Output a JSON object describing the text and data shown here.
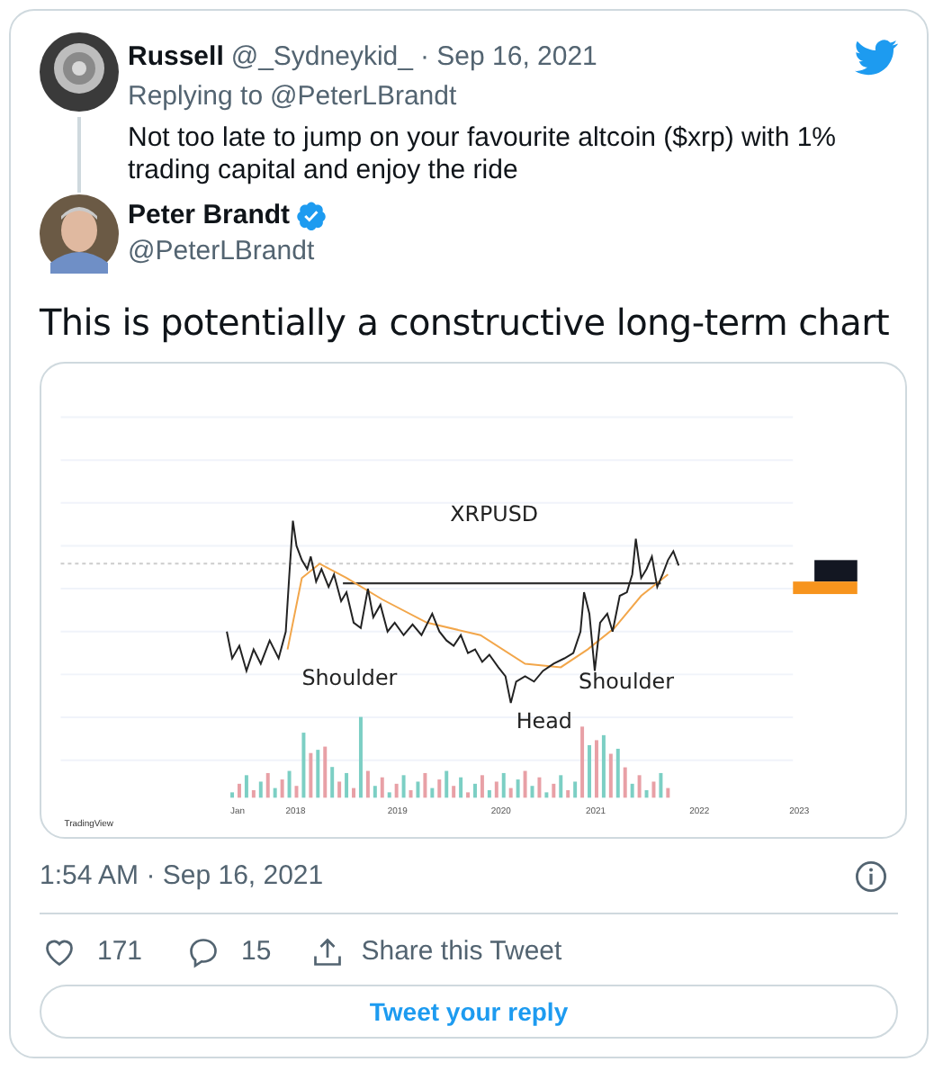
{
  "reply_tweet": {
    "name": "Russell",
    "handle": "@_Sydneykid_",
    "date": "· Sep 16, 2021",
    "replying_to_label": "Replying to",
    "replying_to_handle": "@PeterLBrandt",
    "text": "Not too late to jump on your favourite altcoin ($xrp) with 1% trading capital and enjoy the ride"
  },
  "main_tweet": {
    "name": "Peter Brandt",
    "verified": true,
    "handle": "@PeterLBrandt",
    "text": "This is potentially a constructive long-term chart",
    "attachment": {
      "title": "XRPUSD",
      "annotations": [
        "Shoulder",
        "Shoulder",
        "Head"
      ],
      "x_labels": [
        "Jan",
        "2018",
        "2019",
        "2020",
        "2021",
        "2022",
        "2023"
      ],
      "footer": "TradingView"
    },
    "timestamp": "1:54 AM · Sep 16, 2021",
    "likes": "171",
    "replies": "15",
    "share": "Share this Tweet"
  },
  "reply_button": "Tweet your reply"
}
